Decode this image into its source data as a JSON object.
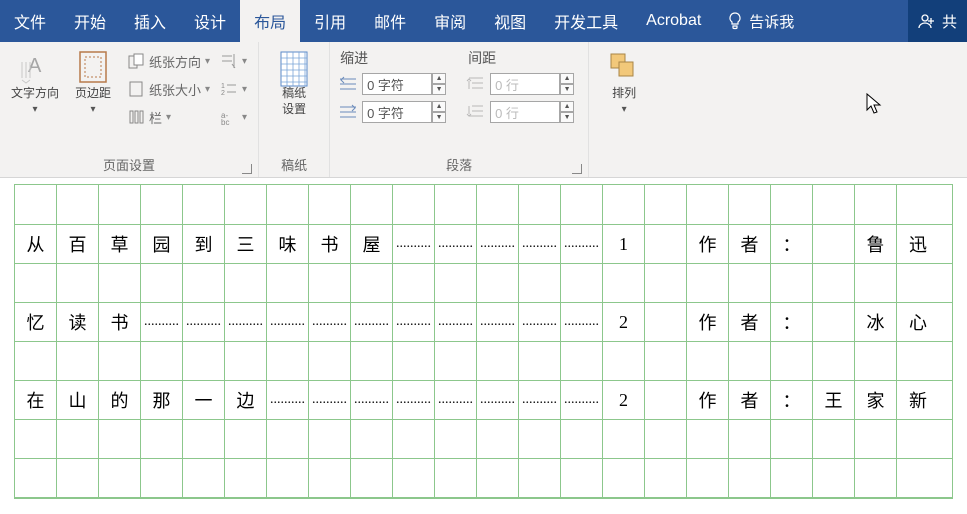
{
  "tabs": {
    "file": "文件",
    "home": "开始",
    "insert": "插入",
    "design": "设计",
    "layout": "布局",
    "references": "引用",
    "mailings": "邮件",
    "review": "审阅",
    "view": "视图",
    "developer": "开发工具",
    "acrobat": "Acrobat",
    "tell_me": "告诉我",
    "share": "共"
  },
  "ribbon": {
    "page_setup": {
      "label": "页面设置",
      "text_direction": "文字方向",
      "margins": "页边距",
      "orientation": "纸张方向",
      "size": "纸张大小",
      "columns": "栏"
    },
    "writing_paper": {
      "label": "稿纸",
      "setting": "稿纸\n设置"
    },
    "paragraph": {
      "label": "段落",
      "indent_title": "缩进",
      "spacing_title": "间距",
      "indent_left": "0 字符",
      "indent_right": "0 字符",
      "space_before": "0 行",
      "space_after": "0 行"
    },
    "arrange": {
      "label": "",
      "arrange_btn": "排列"
    }
  },
  "doc": {
    "rows": [
      {
        "cells": [
          "",
          "",
          "",
          "",
          "",
          "",
          "",
          "",
          "",
          "",
          "",
          "",
          "",
          "",
          "",
          "",
          "",
          "",
          "",
          "",
          "",
          ""
        ],
        "first": true
      },
      {
        "cells": [
          "从",
          "百",
          "草",
          "园",
          "到",
          "三",
          "味",
          "书",
          "屋",
          "dots",
          "dots",
          "dots",
          "dots",
          "dots",
          "1",
          "",
          "作",
          "者",
          "：",
          "",
          "鲁",
          "迅"
        ]
      },
      {
        "cells": [
          "",
          "",
          "",
          "",
          "",
          "",
          "",
          "",
          "",
          "",
          "",
          "",
          "",
          "",
          "",
          "",
          "",
          "",
          "",
          "",
          "",
          ""
        ]
      },
      {
        "cells": [
          "忆",
          "读",
          "书",
          "dots",
          "dots",
          "dots",
          "dots",
          "dots",
          "dots",
          "dots",
          "dots",
          "dots",
          "dots",
          "dots",
          "2",
          "",
          "作",
          "者",
          "：",
          "",
          "冰",
          "心"
        ]
      },
      {
        "cells": [
          "",
          "",
          "",
          "",
          "",
          "",
          "",
          "",
          "",
          "",
          "",
          "",
          "",
          "",
          "",
          "",
          "",
          "",
          "",
          "",
          "",
          ""
        ]
      },
      {
        "cells": [
          "在",
          "山",
          "的",
          "那",
          "一",
          "边",
          "dots",
          "dots",
          "dots",
          "dots",
          "dots",
          "dots",
          "dots",
          "dots",
          "2",
          "",
          "作",
          "者",
          "：",
          "王",
          "家",
          "新"
        ]
      },
      {
        "cells": [
          "",
          "",
          "",
          "",
          "",
          "",
          "",
          "",
          "",
          "",
          "",
          "",
          "",
          "",
          "",
          "",
          "",
          "",
          "",
          "",
          "",
          ""
        ]
      },
      {
        "cells": [
          "",
          "",
          "",
          "",
          "",
          "",
          "",
          "",
          "",
          "",
          "",
          "",
          "",
          "",
          "",
          "",
          "",
          "",
          "",
          "",
          "",
          ""
        ]
      }
    ]
  }
}
